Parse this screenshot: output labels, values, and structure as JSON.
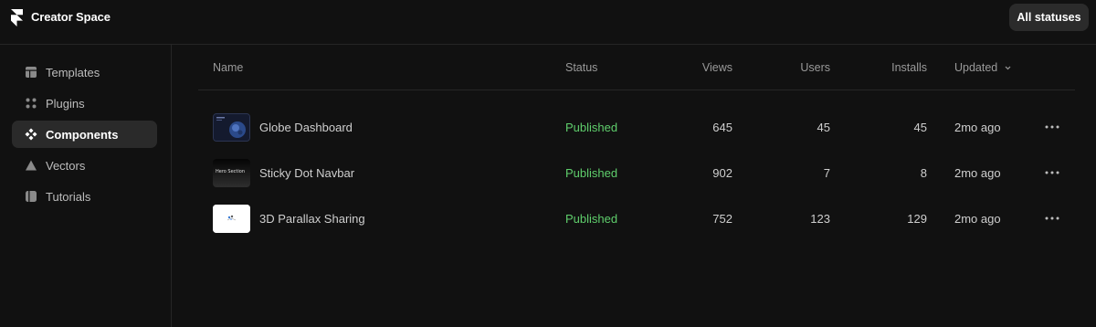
{
  "app": {
    "brand": "Creator Space",
    "status_filter": "All statuses"
  },
  "sidebar": {
    "items": [
      {
        "label": "Templates",
        "icon": "templates-icon",
        "active": false
      },
      {
        "label": "Plugins",
        "icon": "plugins-icon",
        "active": false
      },
      {
        "label": "Components",
        "icon": "components-icon",
        "active": true
      },
      {
        "label": "Vectors",
        "icon": "vectors-icon",
        "active": false
      },
      {
        "label": "Tutorials",
        "icon": "tutorials-icon",
        "active": false
      }
    ]
  },
  "table": {
    "columns": {
      "name": "Name",
      "status": "Status",
      "views": "Views",
      "users": "Users",
      "installs": "Installs",
      "updated": "Updated"
    },
    "rows": [
      {
        "name": "Globe Dashboard",
        "status": "Published",
        "views": "645",
        "users": "45",
        "installs": "45",
        "updated": "2mo ago"
      },
      {
        "name": "Sticky Dot Navbar",
        "status": "Published",
        "views": "902",
        "users": "7",
        "installs": "8",
        "updated": "2mo ago",
        "thumb_text": "Hero Section"
      },
      {
        "name": "3D Parallax Sharing",
        "status": "Published",
        "views": "752",
        "users": "123",
        "installs": "129",
        "updated": "2mo ago"
      }
    ]
  },
  "colors": {
    "background": "#111111",
    "published": "#5fce6c",
    "active_nav": "#2a2a2a"
  }
}
